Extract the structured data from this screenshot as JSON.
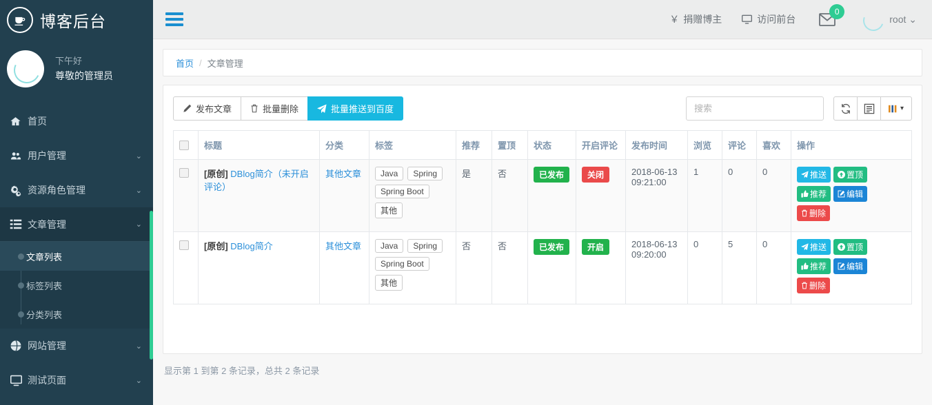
{
  "sidebar": {
    "brand": {
      "title": "博客后台",
      "logo_icon": "coffee-cup-icon"
    },
    "user": {
      "greeting": "下午好",
      "role": "尊敬的管理员",
      "avatar_icon": "user-avatar"
    },
    "items": [
      {
        "label": "首页",
        "icon": "home-icon",
        "has_caret": false
      },
      {
        "label": "用户管理",
        "icon": "users-icon",
        "has_caret": true,
        "caret": "⌄"
      },
      {
        "label": "资源角色管理",
        "icon": "gears-icon",
        "has_caret": true,
        "caret": "⌄"
      },
      {
        "label": "文章管理",
        "icon": "list-icon",
        "has_caret": true,
        "caret": "⌄",
        "open": true
      },
      {
        "label": "网站管理",
        "icon": "globe-icon",
        "has_caret": true,
        "caret": "⌄"
      },
      {
        "label": "测试页面",
        "icon": "monitor-icon",
        "has_caret": true,
        "caret": "⌄"
      }
    ],
    "submenu": [
      {
        "label": "文章列表",
        "active": true
      },
      {
        "label": "标签列表",
        "active": false
      },
      {
        "label": "分类列表",
        "active": false
      }
    ],
    "scrollbar_color": "#2ecc93"
  },
  "topbar": {
    "menu_toggle_icon": "hamburger-icon",
    "donate": {
      "label": "捐赠博主",
      "icon": "yen-icon"
    },
    "visit_site": {
      "label": "访问前台",
      "icon": "monitor-icon"
    },
    "mail": {
      "icon": "envelope-icon",
      "badge": "0",
      "badge_color": "#2ecc93"
    },
    "user": {
      "name": "root",
      "caret": "⌄",
      "avatar_icon": "user-avatar"
    }
  },
  "breadcrumb": {
    "home": "首页",
    "separator": "/",
    "current": "文章管理"
  },
  "toolbar": {
    "publish": {
      "label": "发布文章",
      "icon": "pencil-icon"
    },
    "batch_delete": {
      "label": "批量删除",
      "icon": "trash-icon"
    },
    "push_baidu": {
      "label": "批量推送到百度",
      "icon": "paper-plane-icon",
      "color": "#18b8e0"
    },
    "search_placeholder": "搜索",
    "refresh_icon": "refresh-icon",
    "toggle_view_icon": "list-view-icon",
    "columns_icon": "columns-icon",
    "columns_caret": "▾"
  },
  "table": {
    "columns": [
      "",
      "标题",
      "分类",
      "标签",
      "推荐",
      "置顶",
      "状态",
      "开启评论",
      "发布时间",
      "浏览",
      "评论",
      "喜欢",
      "操作"
    ],
    "rows": [
      {
        "title_prefix": "[原创]",
        "title": "DBlog简介（未开启评论）",
        "category": "其他文章",
        "tags": [
          "Java",
          "Spring",
          "Spring Boot",
          "其他"
        ],
        "recommend": "是",
        "top": "否",
        "status": "已发布",
        "status_color": "#22b24c",
        "comment_open": "关闭",
        "comment_color": "#ea4a4a",
        "publish_time": "2018-06-13 09:21:00",
        "views": "1",
        "comments": "0",
        "likes": "0",
        "actions": [
          {
            "label": "推送",
            "icon": "paper-plane-icon",
            "style": "cyan"
          },
          {
            "label": "置顶",
            "icon": "arrow-up-circle-icon",
            "style": "green"
          },
          {
            "label": "推荐",
            "icon": "thumbs-up-icon",
            "style": "green"
          },
          {
            "label": "编辑",
            "icon": "edit-icon",
            "style": "blue"
          },
          {
            "label": "删除",
            "icon": "trash-icon",
            "style": "red"
          }
        ]
      },
      {
        "title_prefix": "[原创]",
        "title": "DBlog简介",
        "category": "其他文章",
        "tags": [
          "Java",
          "Spring",
          "Spring Boot",
          "其他"
        ],
        "recommend": "否",
        "top": "否",
        "status": "已发布",
        "status_color": "#22b24c",
        "comment_open": "开启",
        "comment_color": "#22b24c",
        "publish_time": "2018-06-13 09:20:00",
        "views": "0",
        "comments": "5",
        "likes": "0",
        "actions": [
          {
            "label": "推送",
            "icon": "paper-plane-icon",
            "style": "cyan"
          },
          {
            "label": "置顶",
            "icon": "arrow-up-circle-icon",
            "style": "green"
          },
          {
            "label": "推荐",
            "icon": "thumbs-up-icon",
            "style": "green"
          },
          {
            "label": "编辑",
            "icon": "edit-icon",
            "style": "blue"
          },
          {
            "label": "删除",
            "icon": "trash-icon",
            "style": "red"
          }
        ]
      }
    ],
    "footer_text": "显示第 1 到第 2 条记录，总共 2 条记录"
  }
}
